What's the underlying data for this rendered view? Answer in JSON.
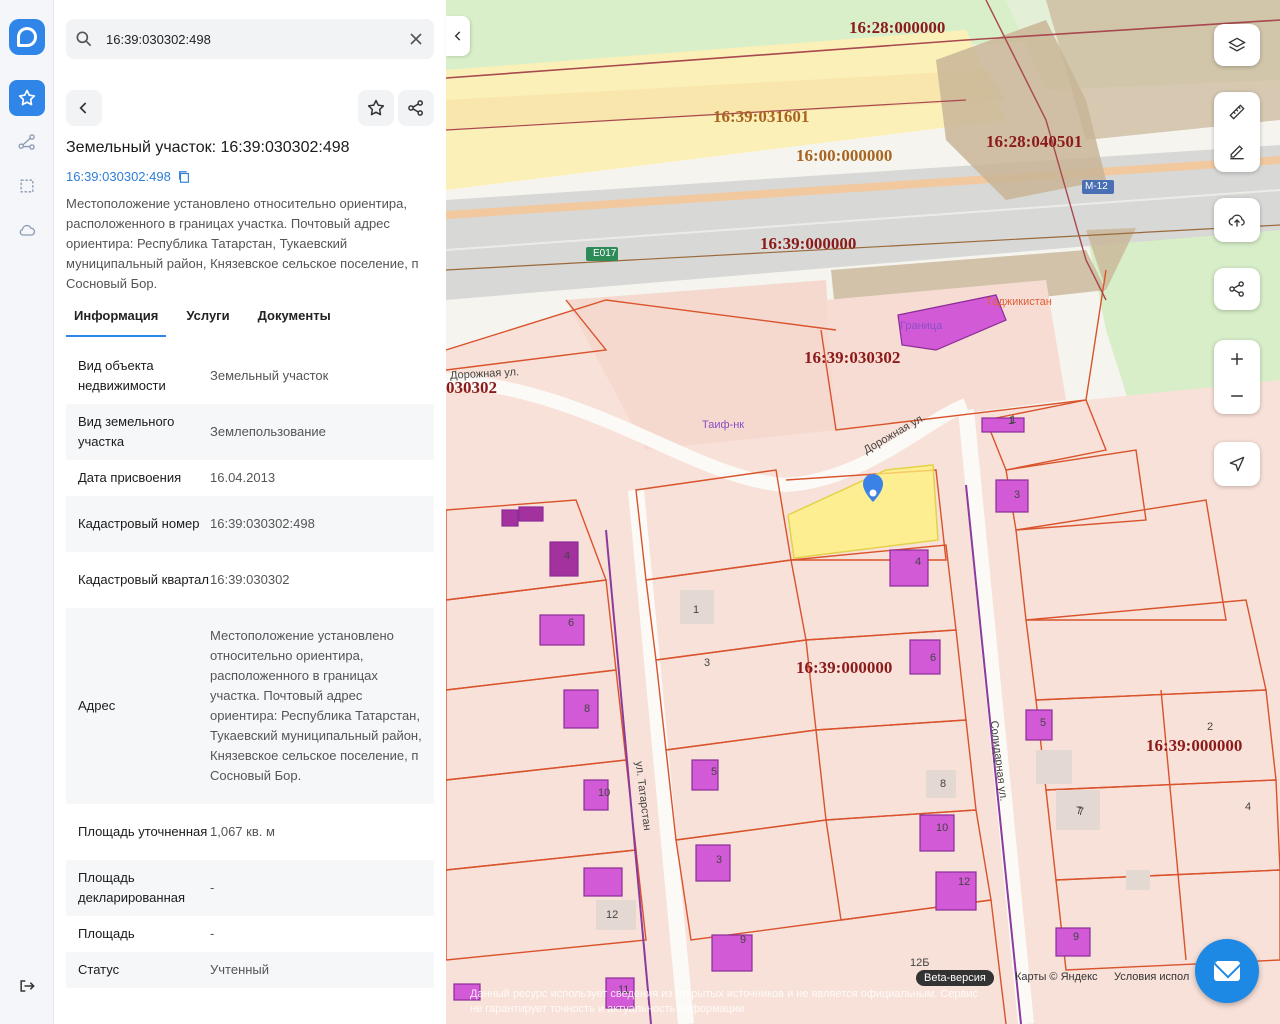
{
  "search": {
    "value": "16:39:030302:498"
  },
  "object": {
    "title": "Земельный участок: 16:39:030302:498",
    "cad_link": "16:39:030302:498",
    "description": "Местоположение установлено относительно ориентира, расположенного в границах участка. Почтовый адрес ориентира: Республика Татарстан, Тукаевский муниципальный район, Князевское сельское поселение, п Сосновый Бор."
  },
  "tabs": [
    {
      "label": "Информация"
    },
    {
      "label": "Услуги"
    },
    {
      "label": "Документы"
    }
  ],
  "info": [
    {
      "key": "Вид объекта недвижимости",
      "value": "Земельный участок"
    },
    {
      "key": "Вид земельного участка",
      "value": "Землепользование"
    },
    {
      "key": "Дата присвоения",
      "value": "16.04.2013"
    },
    {
      "key": "Кадастровый номер",
      "value": "16:39:030302:498"
    },
    {
      "key": "Кадастровый квартал",
      "value": "16:39:030302"
    },
    {
      "key": "Адрес",
      "value": "Местоположение установлено относительно ориентира, расположенного в границах участка. Почтовый адрес ориентира: Республика Татарстан, Тукаевский муниципальный район, Князевское сельское поселение, п Сосновый Бор."
    },
    {
      "key": "Площадь уточненная",
      "value": "1,067 кв. м"
    },
    {
      "key": "Площадь декларированная",
      "value": "-"
    },
    {
      "key": "Площадь",
      "value": "-"
    },
    {
      "key": "Статус",
      "value": "Учтенный"
    }
  ],
  "map": {
    "labels": {
      "q1": "16:28:000000",
      "q2": "16:39:031601",
      "q3": "16:00:000000",
      "q4": "16:28:040501",
      "q5": "16:39:000000",
      "q6": "16:39:030302",
      "q7": "030302",
      "q8": "16:39:000000",
      "q9": "16:39:000000"
    },
    "roads": {
      "e017": "E017",
      "m12": "M-12"
    },
    "streets": {
      "dorozhnaya1": "Дорожная ул.",
      "dorozhnaya2": "Дорожная ул.",
      "tatarstan": "ул. Татарстан",
      "solidarnaya": "Солидарная ул."
    },
    "pois": {
      "tadjik": "Таджикистан",
      "granitsa": "Граница",
      "taif": "Таиф-нк"
    },
    "house_numbers": [
      "1",
      "3",
      "4",
      "6",
      "8",
      "10",
      "12",
      "5",
      "7",
      "9",
      "1",
      "3",
      "4",
      "6",
      "8",
      "10",
      "12",
      "12Б",
      "1",
      "3",
      "5",
      "7",
      "9",
      "2",
      "4",
      "11"
    ],
    "beta": "Beta-версия",
    "attribution": "Карты © Яндекс",
    "terms": "Условия испол",
    "disclaimer": "Данный ресурс использует сведения из открытых источников и не является официальным. Сервис не гарантирует точность и актуальность информации"
  },
  "colors": {
    "accent": "#2f86e8",
    "selected_parcel": "#fff27a",
    "parcel_border": "#d9532c",
    "building": "#d35ad6"
  }
}
